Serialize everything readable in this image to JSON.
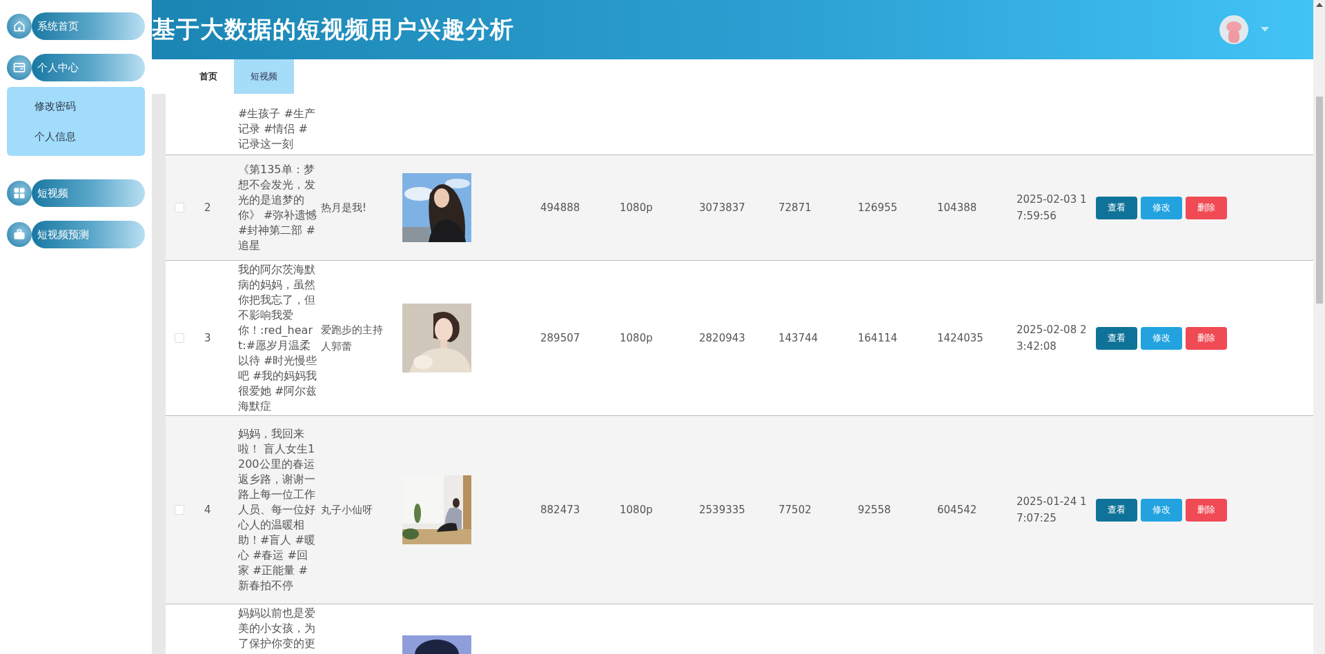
{
  "sidebar": {
    "items": [
      {
        "label": "系统首页"
      },
      {
        "label": "个人中心",
        "expanded": true,
        "children": [
          {
            "label": "修改密码"
          },
          {
            "label": "个人信息"
          }
        ]
      },
      {
        "label": "短视频"
      },
      {
        "label": "短视频预测"
      }
    ]
  },
  "header": {
    "title": "基于大数据的短视频用户兴趣分析"
  },
  "tabs": [
    {
      "label": "首页",
      "selected": false
    },
    {
      "label": "短视频",
      "selected": true
    }
  ],
  "table": {
    "rows": [
      {
        "title": "#生孩子 #生产记录 #情侣 #记录这一刻"
      },
      {
        "checked": false,
        "index": "2",
        "title": "《第135单：梦想不会发光，发光的是追梦的你》 #弥补遗憾 #封神第二部 #追星",
        "author": "热月是我!",
        "image": {
          "kind": "picture"
        },
        "cells": [
          "494888",
          "1080p",
          "3073837",
          "72871",
          "126955",
          "104388"
        ],
        "time": "2025-02-03 17:59:56",
        "actions": [
          {
            "label": "查看",
            "kind": "view"
          },
          {
            "label": "修改",
            "kind": "edit"
          },
          {
            "label": "删除",
            "kind": "delete"
          }
        ]
      },
      {
        "checked": false,
        "index": "3",
        "title": "我的阿尔茨海默病的妈妈，虽然你把我忘了，但不影响我爱你！:red_heart:#愿岁月温柔以待 #时光慢些吧 #我的妈妈我很爱她 #阿尔兹海默症",
        "author": "爱跑步的主持人郭蕾",
        "image": {
          "kind": "picture"
        },
        "cells": [
          "289507",
          "1080p",
          "2820943",
          "143744",
          "164114",
          "1424035"
        ],
        "time": "2025-02-08 23:42:08",
        "actions": [
          {
            "label": "查看",
            "kind": "view"
          },
          {
            "label": "修改",
            "kind": "edit"
          },
          {
            "label": "删除",
            "kind": "delete"
          }
        ]
      },
      {
        "checked": false,
        "index": "4",
        "title": "妈妈，我回来啦！ 盲人女生1200公里的春运返乡路，谢谢一路上每一位工作人员、每一位好心人的温暖相助！#盲人 #暖心 #春运 #回家 #正能量 #新春拍不停",
        "author": "丸子小仙呀",
        "image": {
          "kind": "picture"
        },
        "cells": [
          "882473",
          "1080p",
          "2539335",
          "77502",
          "92558",
          "604542"
        ],
        "time": "2025-01-24 17:07:25",
        "actions": [
          {
            "label": "查看",
            "kind": "view"
          },
          {
            "label": "修改",
            "kind": "edit"
          },
          {
            "label": "删除",
            "kind": "delete"
          }
        ]
      },
      {
        "title": "妈妈以前也是爱美的小女孩，为了保护你变的更",
        "image": {
          "kind": "picture"
        }
      }
    ]
  }
}
